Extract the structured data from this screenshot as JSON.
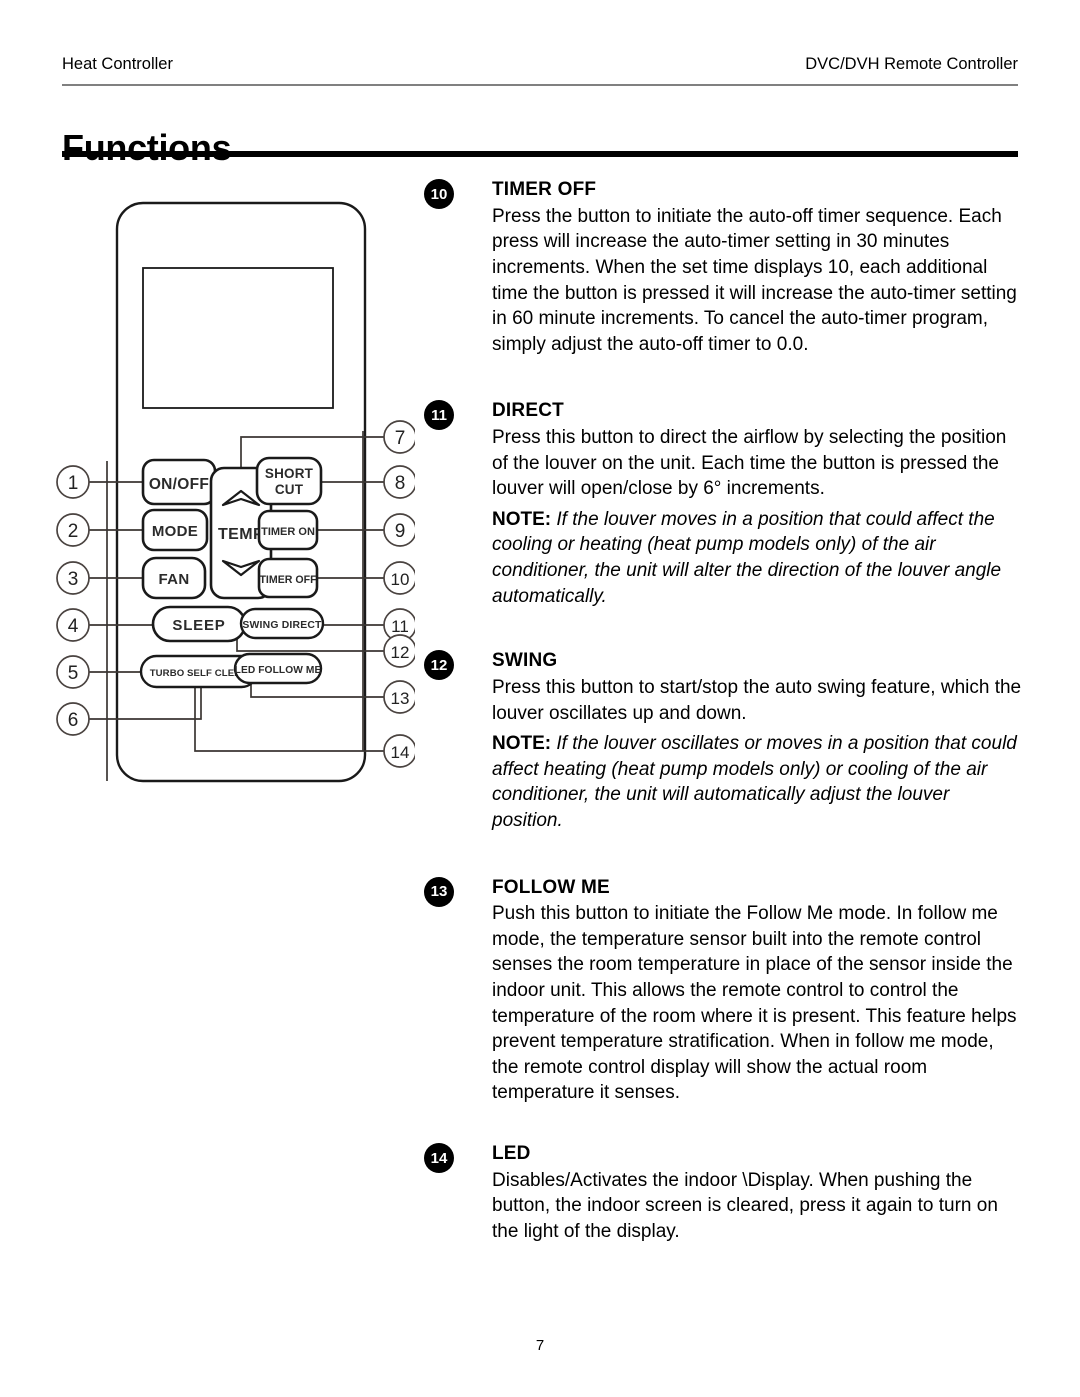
{
  "header": {
    "left": "Heat Controller",
    "right": "DVC/DVH Remote Controller"
  },
  "title": "Functions",
  "page_number": "7",
  "remote": {
    "caption": "remote controller button layout diagram",
    "display_label": "",
    "buttons": [
      {
        "id": "on-off",
        "label": "ON/OFF"
      },
      {
        "id": "mode",
        "label": "MODE"
      },
      {
        "id": "fan",
        "label": "FAN"
      },
      {
        "id": "sleep",
        "label": "SLEEP"
      },
      {
        "id": "turbo-self-clean",
        "label": "TURBO SELF CLEAN"
      },
      {
        "id": "temp",
        "label": "TEMP"
      },
      {
        "id": "short-cut-1",
        "label": "SHORT"
      },
      {
        "id": "short-cut-2",
        "label": "CUT"
      },
      {
        "id": "timer-on",
        "label": "TIMER ON"
      },
      {
        "id": "timer-off",
        "label": "TIMER OFF"
      },
      {
        "id": "swing-direct",
        "label": "SWING  DIRECT"
      },
      {
        "id": "led-follow-me",
        "label": "LED FOLLOW ME"
      }
    ],
    "callouts": [
      {
        "n": "1",
        "side": "left"
      },
      {
        "n": "2",
        "side": "left"
      },
      {
        "n": "3",
        "side": "left"
      },
      {
        "n": "4",
        "side": "left"
      },
      {
        "n": "5",
        "side": "left"
      },
      {
        "n": "6",
        "side": "left"
      },
      {
        "n": "7",
        "side": "right"
      },
      {
        "n": "8",
        "side": "right"
      },
      {
        "n": "9",
        "side": "right"
      },
      {
        "n": "10",
        "side": "right"
      },
      {
        "n": "11",
        "side": "right"
      },
      {
        "n": "12",
        "side": "right"
      },
      {
        "n": "13",
        "side": "right"
      },
      {
        "n": "14",
        "side": "right"
      }
    ]
  },
  "functions": [
    {
      "number": "10",
      "title": "TIMER OFF",
      "body": "Press the button to initiate the auto-off timer sequence. Each press will increase the auto-timer setting in 30 minutes increments. When the set time displays 10, each additional time the button is pressed it will increase the auto-timer setting in 60 minute increments. To cancel the auto-timer program, simply adjust the auto-off timer to 0.0.",
      "note_label": "",
      "note": ""
    },
    {
      "number": "11",
      "title": "DIRECT",
      "body": "Press this button to direct the airflow by selecting the position of the louver on the unit. Each time the button is pressed the louver will open/close by 6° increments.",
      "note_label": "NOTE:",
      "note": "If the louver moves in a position that could affect the cooling or heating (heat pump models only) of the air conditioner, the unit will alter the direction of the louver angle automatically."
    },
    {
      "number": "12",
      "title": "SWING",
      "body": "Press this button to start/stop the auto swing feature, which the louver oscillates up and down.",
      "note_label": "NOTE:",
      "note": "If the louver oscillates or moves in a position that could affect heating (heat pump models only) or cooling of the air conditioner, the unit will automatically adjust the louver position."
    },
    {
      "number": "13",
      "title": "FOLLOW ME",
      "body": "Push this button to initiate the Follow Me mode. In follow me mode, the temperature sensor built into the remote control senses the room temperature in place of the sensor inside the indoor unit. This allows the remote control to control the temperature of the room where it is present. This feature helps prevent temperature stratification. When in follow me mode, the remote control display will show the actual room temperature it senses.",
      "note_label": "",
      "note": ""
    },
    {
      "number": "14",
      "title": "LED",
      "body": "Disables/Activates the indoor \\Display. When pushing the button, the indoor screen is cleared, press it again to turn on the light of the display.",
      "note_label": "",
      "note": ""
    }
  ]
}
